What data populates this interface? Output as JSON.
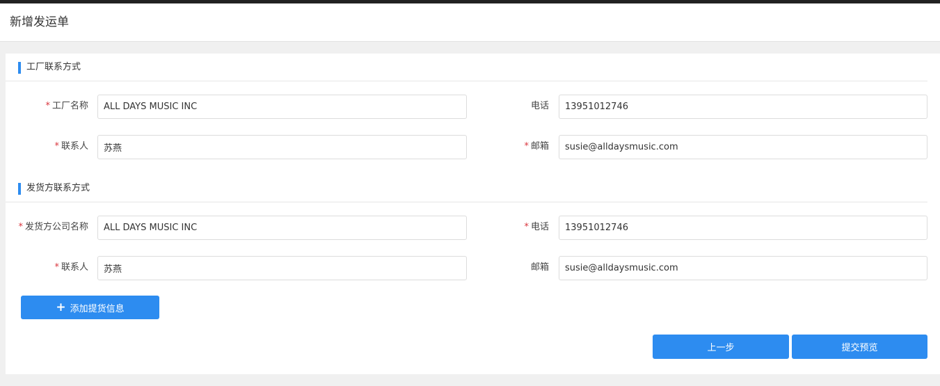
{
  "page": {
    "title": "新增发运单"
  },
  "factory_section": {
    "title": "工厂联系方式",
    "name_label": "工厂名称",
    "name_value": "ALL DAYS MUSIC INC",
    "phone_label": "电话",
    "phone_value": "13951012746",
    "contact_label": "联系人",
    "contact_value": "苏燕",
    "email_label": "邮箱",
    "email_value": "susie@alldaysmusic.com",
    "required_mark": "*"
  },
  "shipper_section": {
    "title": "发货方联系方式",
    "company_label": "发货方公司名称",
    "company_value": "ALL DAYS MUSIC INC",
    "phone_label": "电话",
    "phone_value": "13951012746",
    "contact_label": "联系人",
    "contact_value": "苏燕",
    "email_label": "邮箱",
    "email_value": "susie@alldaysmusic.com",
    "required_mark": "*"
  },
  "actions": {
    "add_pickup_label": "添加提货信息",
    "add_icon": "plus-icon",
    "prev_label": "上一步",
    "submit_label": "提交预览"
  },
  "colors": {
    "accent": "#2d8cf0",
    "required": "#d9363e"
  }
}
